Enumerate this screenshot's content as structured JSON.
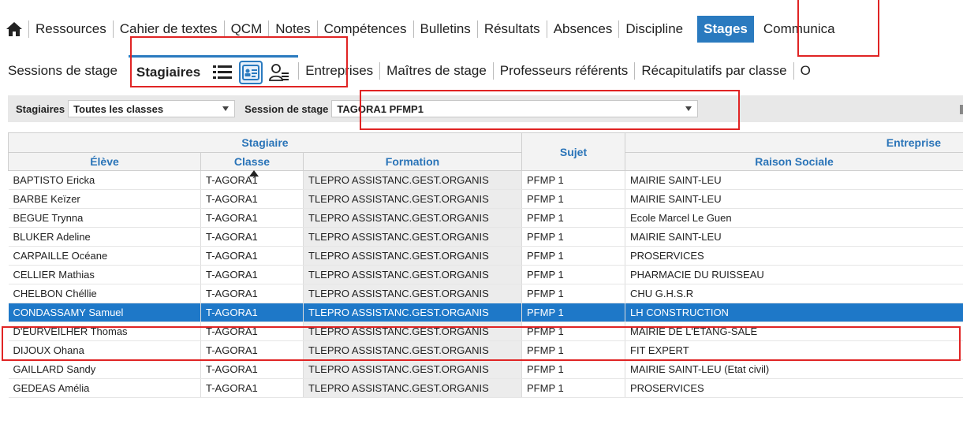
{
  "top_menu": {
    "home_icon": "home-icon",
    "items": [
      "Ressources",
      "Cahier de textes",
      "QCM",
      "Notes",
      "Compétences",
      "Bulletins",
      "Résultats",
      "Absences",
      "Discipline",
      "Stages",
      "Communica"
    ],
    "active": "Stages"
  },
  "sub_menu": {
    "first": "Sessions de stage",
    "active_label": "Stagiaires",
    "view_icons": [
      "list-view-icon",
      "card-view-icon",
      "person-list-icon"
    ],
    "items": [
      "Entreprises",
      "Maîtres de stage",
      "Professeurs référents",
      "Récapitulatifs par classe",
      "O"
    ]
  },
  "filter": {
    "stagiaires_label": "Stagiaires",
    "classes_value": "Toutes les classes",
    "session_label": "Session de stage",
    "session_value": "TAGORA1 PFMP1"
  },
  "grid": {
    "group_stagiaire": "Stagiaire",
    "group_sujet": "Sujet",
    "group_entreprise": "Entreprise",
    "columns": {
      "eleve": "Élève",
      "classe": "Classe",
      "formation": "Formation",
      "raison": "Raison Sociale"
    },
    "rows": [
      {
        "eleve": "BAPTISTO Ericka",
        "classe": "T-AGORA1",
        "formation": "TLEPRO ASSISTANC.GEST.ORGANIS",
        "sujet": "PFMP 1",
        "raison": "MAIRIE SAINT-LEU"
      },
      {
        "eleve": "BARBE Keïzer",
        "classe": "T-AGORA1",
        "formation": "TLEPRO ASSISTANC.GEST.ORGANIS",
        "sujet": "PFMP 1",
        "raison": "MAIRIE SAINT-LEU"
      },
      {
        "eleve": "BEGUE Trynna",
        "classe": "T-AGORA1",
        "formation": "TLEPRO ASSISTANC.GEST.ORGANIS",
        "sujet": "PFMP 1",
        "raison": "Ecole Marcel Le Guen"
      },
      {
        "eleve": "BLUKER Adeline",
        "classe": "T-AGORA1",
        "formation": "TLEPRO ASSISTANC.GEST.ORGANIS",
        "sujet": "PFMP 1",
        "raison": "MAIRIE SAINT-LEU"
      },
      {
        "eleve": "CARPAILLE Océane",
        "classe": "T-AGORA1",
        "formation": "TLEPRO ASSISTANC.GEST.ORGANIS",
        "sujet": "PFMP 1",
        "raison": "PROSERVICES"
      },
      {
        "eleve": "CELLIER Mathias",
        "classe": "T-AGORA1",
        "formation": "TLEPRO ASSISTANC.GEST.ORGANIS",
        "sujet": "PFMP 1",
        "raison": "PHARMACIE DU RUISSEAU"
      },
      {
        "eleve": "CHELBON Chéllie",
        "classe": "T-AGORA1",
        "formation": "TLEPRO ASSISTANC.GEST.ORGANIS",
        "sujet": "PFMP 1",
        "raison": "CHU G.H.S.R"
      },
      {
        "eleve": "CONDASSAMY Samuel",
        "classe": "T-AGORA1",
        "formation": "TLEPRO ASSISTANC.GEST.ORGANIS",
        "sujet": "PFMP 1",
        "raison": "LH CONSTRUCTION"
      },
      {
        "eleve": "D'EURVEILHER Thomas",
        "classe": "T-AGORA1",
        "formation": "TLEPRO ASSISTANC.GEST.ORGANIS",
        "sujet": "PFMP 1",
        "raison": "MAIRIE DE L'ETANG-SALE"
      },
      {
        "eleve": "DIJOUX Ohana",
        "classe": "T-AGORA1",
        "formation": "TLEPRO ASSISTANC.GEST.ORGANIS",
        "sujet": "PFMP 1",
        "raison": "FIT EXPERT"
      },
      {
        "eleve": "GAILLARD Sandy",
        "classe": "T-AGORA1",
        "formation": "TLEPRO ASSISTANC.GEST.ORGANIS",
        "sujet": "PFMP 1",
        "raison": "MAIRIE SAINT-LEU (Etat civil)"
      },
      {
        "eleve": "GEDEAS Amélia",
        "classe": "T-AGORA1",
        "formation": "TLEPRO ASSISTANC.GEST.ORGANIS",
        "sujet": "PFMP 1",
        "raison": "PROSERVICES"
      }
    ],
    "selected_index": 7
  },
  "colors": {
    "accent": "#2a7abf",
    "selected_row": "#1e78c8",
    "annotation": "#e02424",
    "header_text": "#2a74b8"
  }
}
